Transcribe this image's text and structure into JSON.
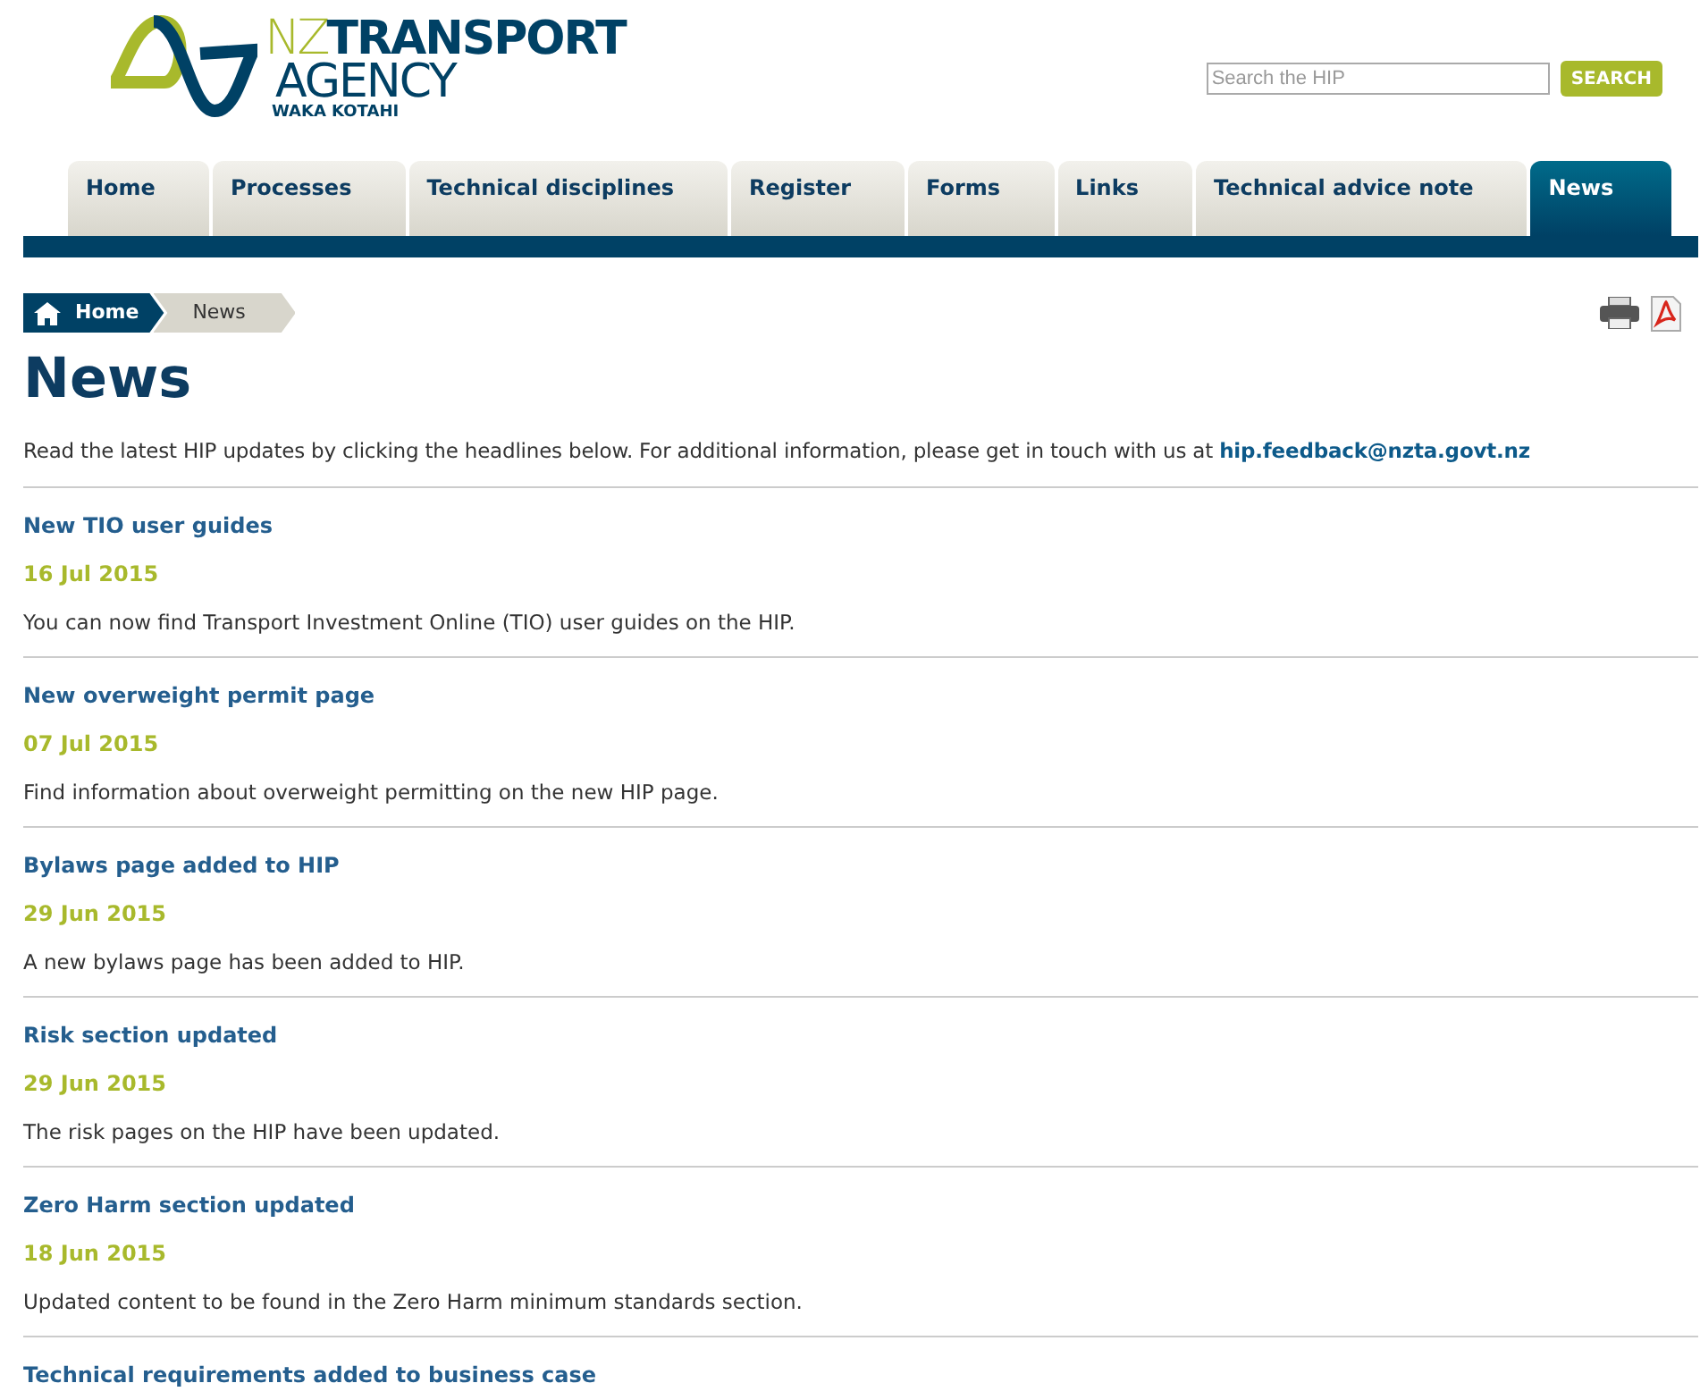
{
  "logo": {
    "nz": "NZ",
    "transport": "TRANSPORT",
    "agency": "AGENCY",
    "subtitle": "WAKA KOTAHI"
  },
  "search": {
    "placeholder": "Search the HIP",
    "button": "SEARCH"
  },
  "tabs": [
    {
      "label": "Home",
      "selected": false
    },
    {
      "label": "Processes",
      "selected": false
    },
    {
      "label": "Technical disciplines",
      "selected": false
    },
    {
      "label": "Register",
      "selected": false
    },
    {
      "label": "Forms",
      "selected": false
    },
    {
      "label": "Links",
      "selected": false
    },
    {
      "label": "Technical advice note",
      "selected": false
    },
    {
      "label": "News",
      "selected": true
    }
  ],
  "breadcrumb": [
    "Home",
    "News"
  ],
  "title": "News",
  "intro": {
    "text": "Read the latest HIP updates by clicking the headlines below. For additional information, please get in touch with us at",
    "email": "hip.feedback@nzta.govt.nz"
  },
  "news": [
    {
      "headline": "New TIO user guides",
      "date": "16 Jul 2015",
      "summary": "You can now find Transport Investment Online (TIO) user guides on the HIP."
    },
    {
      "headline": "New overweight permit page",
      "date": "07 Jul 2015",
      "summary": "Find information about overweight permitting on the new HIP page."
    },
    {
      "headline": "Bylaws page added to HIP",
      "date": "29 Jun 2015",
      "summary": "A new bylaws page has been added to HIP."
    },
    {
      "headline": "Risk section updated",
      "date": "29 Jun 2015",
      "summary": "The risk pages on the HIP have been updated."
    },
    {
      "headline": "Zero Harm section updated",
      "date": "18 Jun 2015",
      "summary": "Updated content to be found in the Zero Harm minimum standards section."
    },
    {
      "headline": "Technical requirements added to business case"
    }
  ]
}
